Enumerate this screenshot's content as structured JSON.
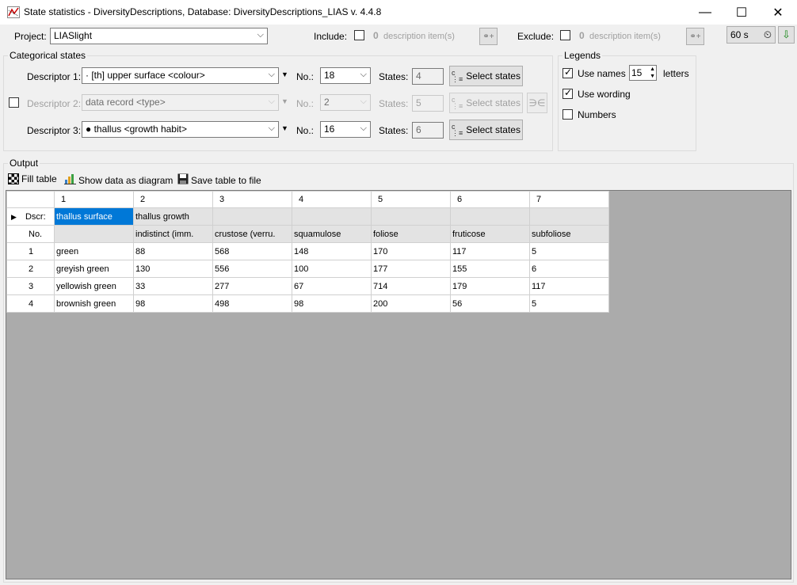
{
  "window": {
    "title": "State statistics - DiversityDescriptions,  Database: DiversityDescriptions_LIAS    v. 4.4.8",
    "minimize": "—",
    "maximize": "☐",
    "close": "✕"
  },
  "project": {
    "label": "Project:",
    "value": "LIASlight"
  },
  "include": {
    "label": "Include:",
    "count": "0",
    "text": "description item(s)"
  },
  "exclude": {
    "label": "Exclude:",
    "count": "0",
    "text": "description item(s)"
  },
  "timer": {
    "value": "60 s"
  },
  "categorical": {
    "title": "Categorical states",
    "descriptors": [
      {
        "label": "Descriptor 1:",
        "value": "·  [th] upper surface <colour>",
        "no_label": "No.:",
        "no": "18",
        "states_label": "States:",
        "states": "4",
        "button": "Select states"
      },
      {
        "label": "Descriptor 2:",
        "value": "data record <type>",
        "no_label": "No.:",
        "no": "2",
        "states_label": "States:",
        "states": "5",
        "button": "Select states",
        "extra": "∋∈"
      },
      {
        "label": "Descriptor 3:",
        "value": "● thallus <growth habit>",
        "no_label": "No.:",
        "no": "16",
        "states_label": "States:",
        "states": "6",
        "button": "Select states"
      }
    ]
  },
  "legends": {
    "title": "Legends",
    "use_names": "Use names",
    "letters_value": "15",
    "letters": "letters",
    "use_wording": "Use wording",
    "numbers": "Numbers"
  },
  "output": {
    "title": "Output",
    "fill_table": "Fill table",
    "show_diagram": "Show data as diagram",
    "save_table": "Save table to file"
  },
  "table": {
    "col_numbers": [
      "1",
      "2",
      "3",
      "4",
      "5",
      "6",
      "7"
    ],
    "dscr_label": "Dscr:",
    "dscr_row": [
      "thallus surface",
      "thallus growth",
      "",
      "",
      "",
      "",
      ""
    ],
    "no_label": "No.",
    "no_row": [
      "",
      "indistinct (imm.",
      "crustose (verru.",
      "squamulose",
      "foliose",
      "fruticose",
      "subfoliose"
    ],
    "rows": [
      {
        "no": "1",
        "cells": [
          "green",
          "88",
          "568",
          "148",
          "170",
          "117",
          "5"
        ]
      },
      {
        "no": "2",
        "cells": [
          "greyish green",
          "130",
          "556",
          "100",
          "177",
          "155",
          "6"
        ]
      },
      {
        "no": "3",
        "cells": [
          "yellowish green",
          "33",
          "277",
          "67",
          "714",
          "179",
          "117"
        ]
      },
      {
        "no": "4",
        "cells": [
          "brownish green",
          "98",
          "498",
          "98",
          "200",
          "56",
          "5"
        ]
      }
    ]
  }
}
